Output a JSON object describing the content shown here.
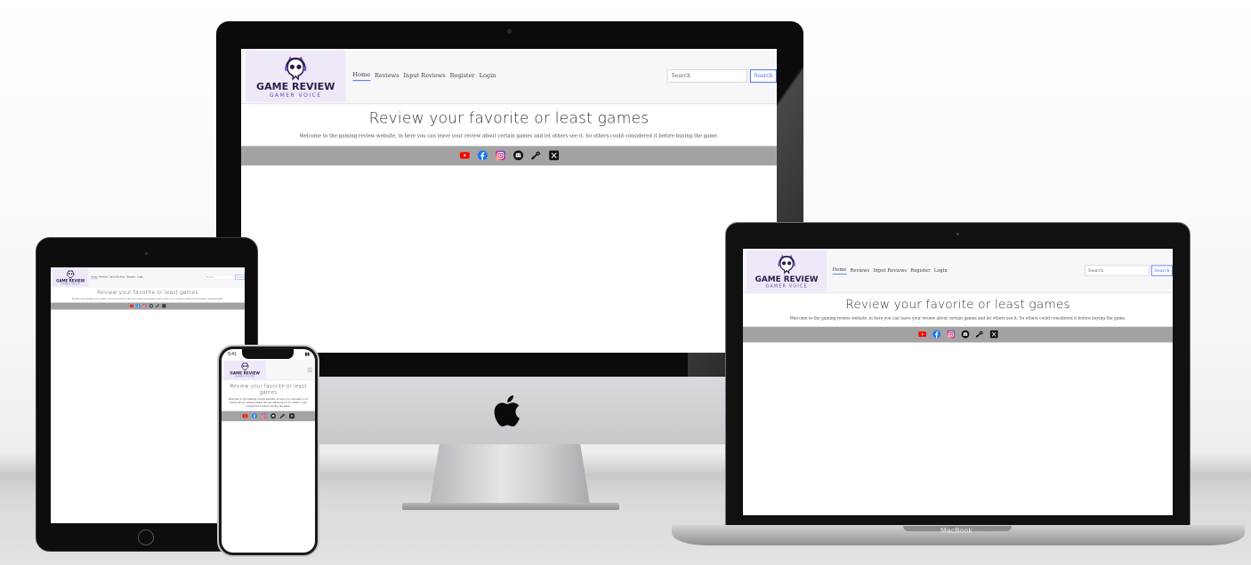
{
  "site": {
    "logo": {
      "title": "GAME REVIEW",
      "subtitle": "GAMER VOICE"
    },
    "nav": [
      {
        "label": "Home",
        "active": true
      },
      {
        "label": "Reviews",
        "active": false
      },
      {
        "label": "Input Reviews",
        "active": false
      },
      {
        "label": "Register",
        "active": false
      },
      {
        "label": "Login",
        "active": false
      }
    ],
    "search": {
      "placeholder": "Search",
      "button_label": "Search"
    },
    "hero": {
      "heading": "Review your favorite or least games",
      "intro": "Welcome to the gaming review website, in here you can leave your review about certain games and let others see it. So others could considered it before buying the game."
    },
    "socials": [
      {
        "icon": "youtube-icon",
        "color": "#ff0000"
      },
      {
        "icon": "facebook-icon",
        "color": "#1877f2"
      },
      {
        "icon": "instagram-icon",
        "color": "#e1306c"
      },
      {
        "icon": "discord-icon",
        "color": "#111111"
      },
      {
        "icon": "steam-icon",
        "color": "#111111"
      },
      {
        "icon": "x-icon",
        "color": "#111111"
      }
    ],
    "social_bar_color": "#a3a3a3"
  },
  "devices": {
    "laptop_label": "MacBook",
    "phone_time": "9:41"
  }
}
